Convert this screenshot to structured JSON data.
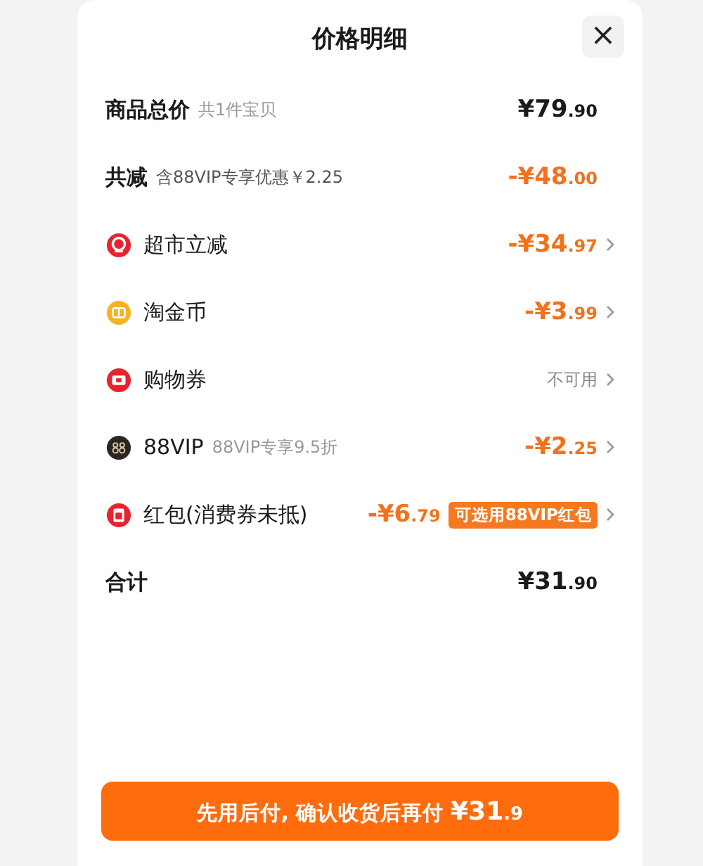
{
  "title": "价格明细",
  "close": {
    "label": "×"
  },
  "rows": [
    {
      "kind": "summary",
      "label": "商品总价",
      "note": "共1件宝贝",
      "amount": {
        "discount": false,
        "main": "¥79",
        "cents": ".90"
      },
      "chevron": false
    },
    {
      "kind": "summary",
      "label": "共减",
      "note": "含88VIP专享优惠￥2.25",
      "amount": {
        "discount": true,
        "main": "-¥48",
        "cents": ".00"
      },
      "chevron": false
    },
    {
      "kind": "market",
      "label": "超市立减",
      "amount": {
        "discount": true,
        "main": "-¥34",
        "cents": ".97"
      },
      "chevron": true
    },
    {
      "kind": "coin",
      "label": "淘金币",
      "amount": {
        "discount": true,
        "main": "-¥3",
        "cents": ".99"
      },
      "chevron": true
    },
    {
      "kind": "ticket",
      "label": "购物券",
      "status": "不可用",
      "chevron": true
    },
    {
      "kind": "vip",
      "label": "88VIP",
      "note": "88VIP专享9.5折",
      "amount": {
        "discount": true,
        "main": "-¥2",
        "cents": ".25"
      },
      "chevron": true
    },
    {
      "kind": "packet",
      "label": "红包(消费券未抵)",
      "amount": {
        "discount": true,
        "main": "-¥6",
        "cents": ".79"
      },
      "badge": "可选用88VIP红包",
      "chevron": true
    },
    {
      "kind": "summary",
      "label": "合计",
      "amount": {
        "discount": false,
        "main": "¥31",
        "cents": ".90"
      },
      "chevron": false
    }
  ],
  "pay_button": {
    "label": "先用后付, 确认收货后再付",
    "main": "¥31",
    "cents": ".9"
  }
}
